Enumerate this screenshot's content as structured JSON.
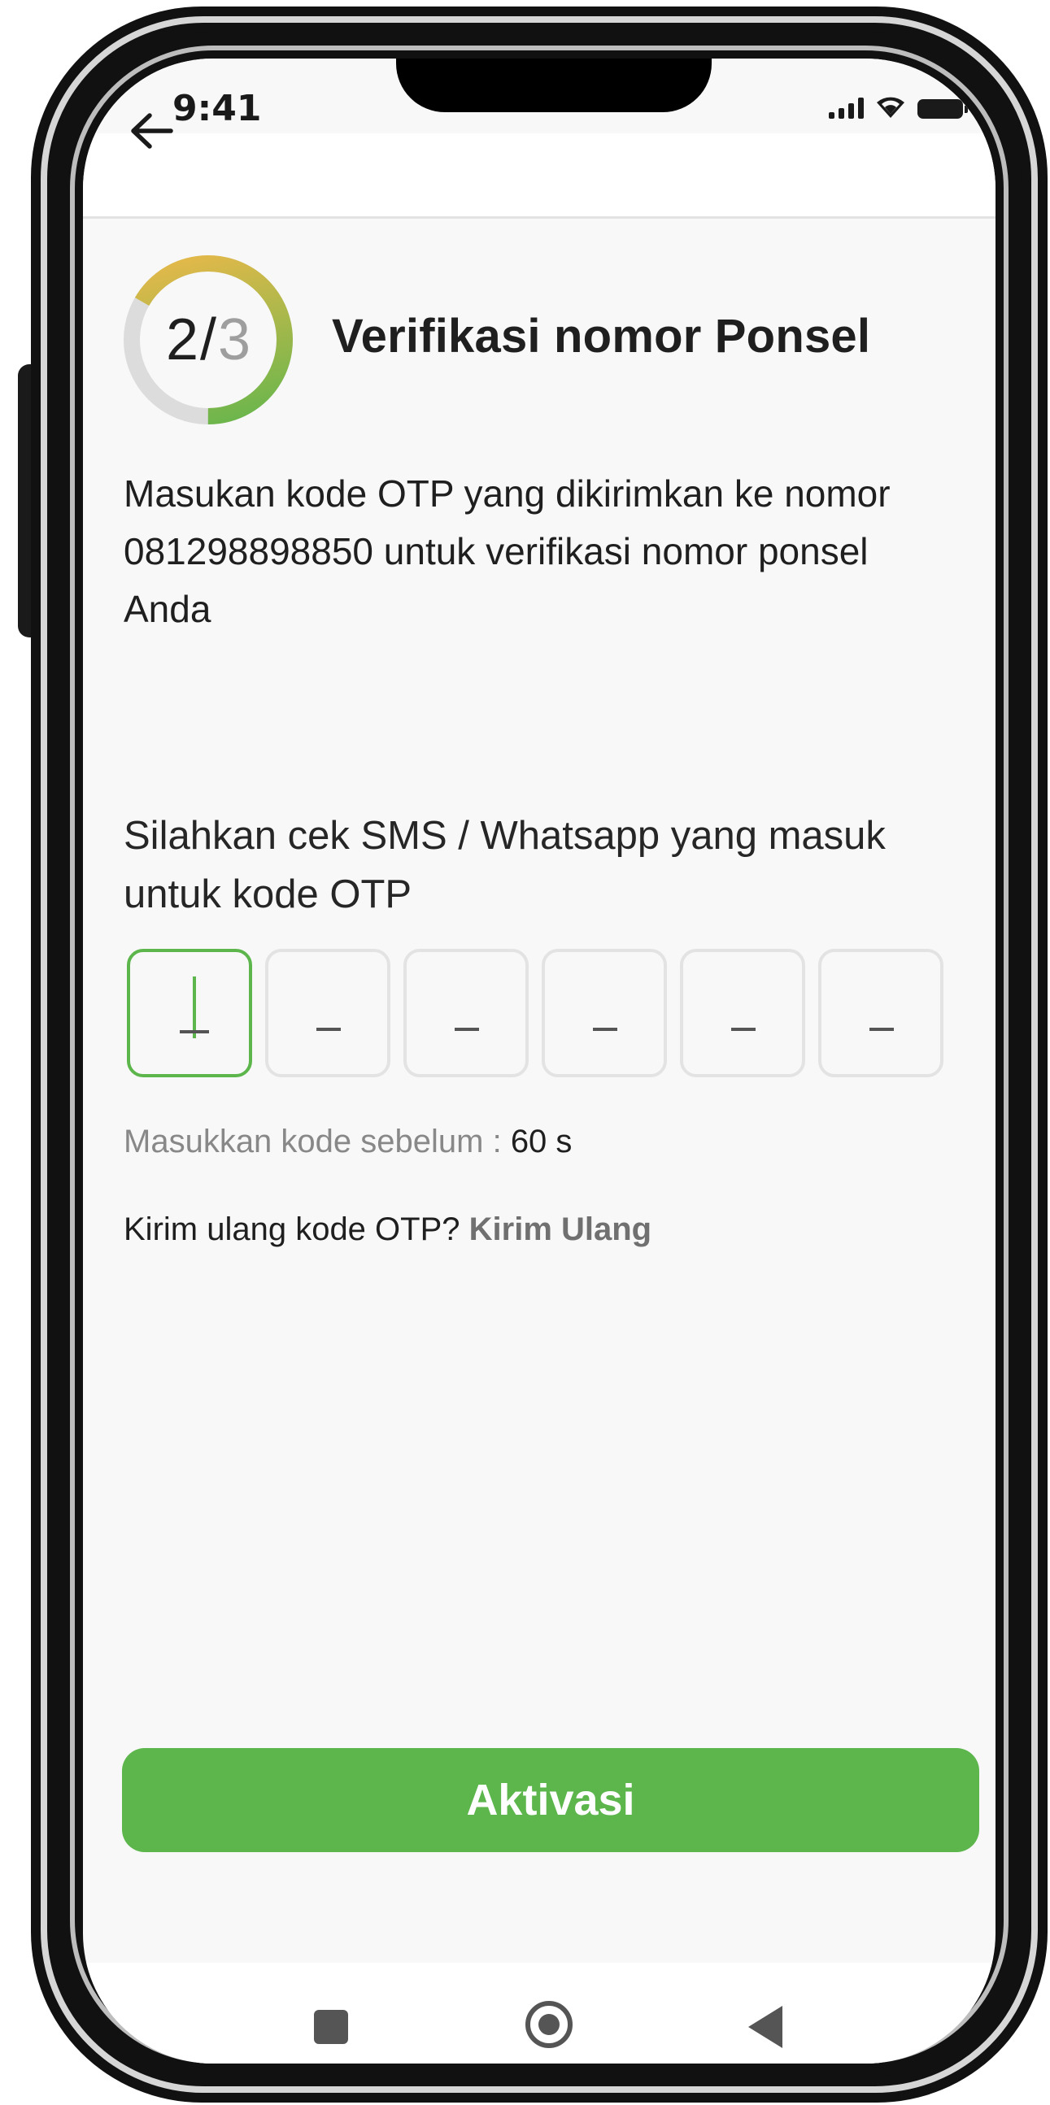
{
  "status_bar": {
    "time": "9:41"
  },
  "header": {
    "back_icon": "arrow-left-icon"
  },
  "progress": {
    "current": "2",
    "separator": "/",
    "total": "3",
    "fraction": 0.6667
  },
  "page": {
    "title": "Verifikasi nomor Ponsel",
    "description": "Masukan kode OTP yang dikirimkan ke nomor 081298898850 untuk verifikasi nomor ponsel Anda",
    "instruction": "Silahkan cek SMS / Whatsapp yang masuk untuk kode OTP"
  },
  "otp": {
    "digits": [
      "",
      "",
      "",
      "",
      "",
      ""
    ],
    "placeholder": "_"
  },
  "timer": {
    "label": "Masukkan kode sebelum : ",
    "value": "60 s"
  },
  "resend": {
    "prompt": "Kirim ulang kode OTP? ",
    "link": "Kirim Ulang"
  },
  "cta": {
    "label": "Aktivasi"
  },
  "colors": {
    "accent": "#5cb64c",
    "ring_start": "#5cb64c",
    "ring_end": "#f2b94a",
    "ring_track": "#dcdcdc"
  },
  "nav": {
    "icons": [
      "recents-square-icon",
      "home-circle-icon",
      "back-triangle-icon"
    ]
  }
}
